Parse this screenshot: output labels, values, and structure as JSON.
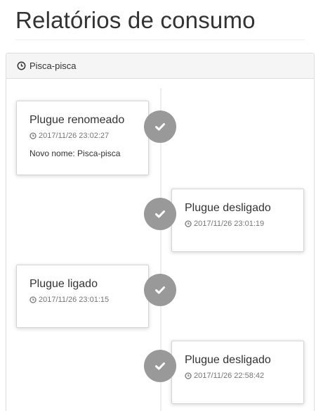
{
  "header": {
    "title": "Relatórios de consumo"
  },
  "panel": {
    "heading_icon": "clock-icon",
    "heading_label": "Pisca-pisca"
  },
  "colors": {
    "badge": "#999999",
    "line": "#eeeeee",
    "heading_bg": "#f5f5f5"
  },
  "timeline": [
    {
      "title": "Plugue renomeado",
      "time": "2017/11/26 23:02:27",
      "body": "Novo nome: Pisca-pisca",
      "side": "left",
      "icon": "check-icon"
    },
    {
      "title": "Plugue desligado",
      "time": "2017/11/26 23:01:19",
      "side": "right",
      "icon": "check-icon"
    },
    {
      "title": "Plugue ligado",
      "time": "2017/11/26 23:01:15",
      "side": "left",
      "icon": "check-icon"
    },
    {
      "title": "Plugue desligado",
      "time": "2017/11/26 22:58:42",
      "side": "right",
      "icon": "check-icon"
    }
  ]
}
